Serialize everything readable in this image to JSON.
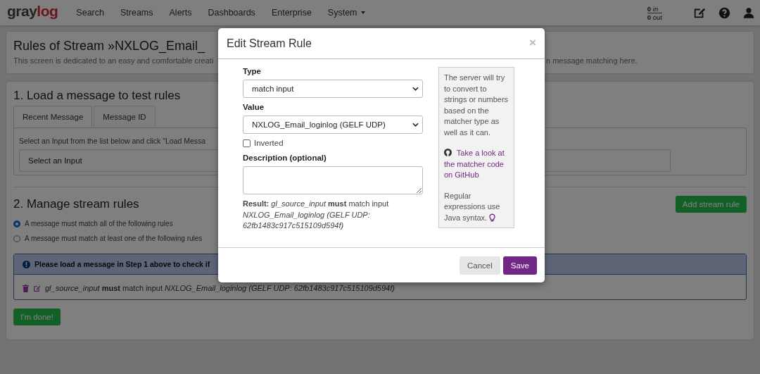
{
  "navbar": {
    "logo": {
      "first": "gray",
      "second": "log"
    },
    "items": [
      {
        "label": "Search",
        "dropdown": false
      },
      {
        "label": "Streams",
        "dropdown": false
      },
      {
        "label": "Alerts",
        "dropdown": false
      },
      {
        "label": "Dashboards",
        "dropdown": false
      },
      {
        "label": "Enterprise",
        "dropdown": false
      },
      {
        "label": "System",
        "dropdown": true
      }
    ],
    "throughput": {
      "in": "**0** *in*",
      "out": "**0** *out*"
    }
  },
  "header": {
    "title": "Rules of Stream »NXLOG_Email_",
    "description_start": "This screen is dedicated to an easy and comfortable creati",
    "description_end": "n message matching here."
  },
  "step1": {
    "heading": "1. Load a message to test rules",
    "tabs": [
      {
        "label": "Recent Message",
        "selected": true
      },
      {
        "label": "Message ID",
        "selected": false
      }
    ],
    "instruction": "Select an Input from the list below and click \"Load Messa",
    "input_select": "Select an Input"
  },
  "step2": {
    "heading": "2. Manage stream rules",
    "add_button": "Add stream rule",
    "match_options": [
      {
        "label": "A message must match all of the following rules",
        "selected": true
      },
      {
        "label": "A message must match at least one of the following rules",
        "selected": false
      }
    ],
    "info": "Please load a message in Step 1 above to check if",
    "rules": [
      "*gl_source_input* **must** match input *NXLOG_Email_loginlog (GELF UDP: 62fb1483c917c515109d594f)*"
    ],
    "done_button": "I'm done!"
  },
  "modal": {
    "title": "Edit Stream Rule",
    "close": "×",
    "type_label": "Type",
    "type_value": "match input",
    "value_label": "Value",
    "value_value": "NXLOG_Email_loginlog (GELF UDP)",
    "inverted": {
      "label": "Inverted",
      "checked": false
    },
    "description_label": "Description (optional)",
    "result": "**Result:** *gl_source_input* **must** match input *NXLOG_Email_loginlog (GELF UDP: 62fb1483c917c515109d594f)*",
    "help": {
      "intro": "The server will try to convert to strings or numbers based on the matcher type as well as it can.",
      "link": "Take a look at the matcher code on GitHub",
      "regex": "Regular expressions use Java syntax."
    },
    "cancel": "Cancel",
    "save": "Save"
  }
}
